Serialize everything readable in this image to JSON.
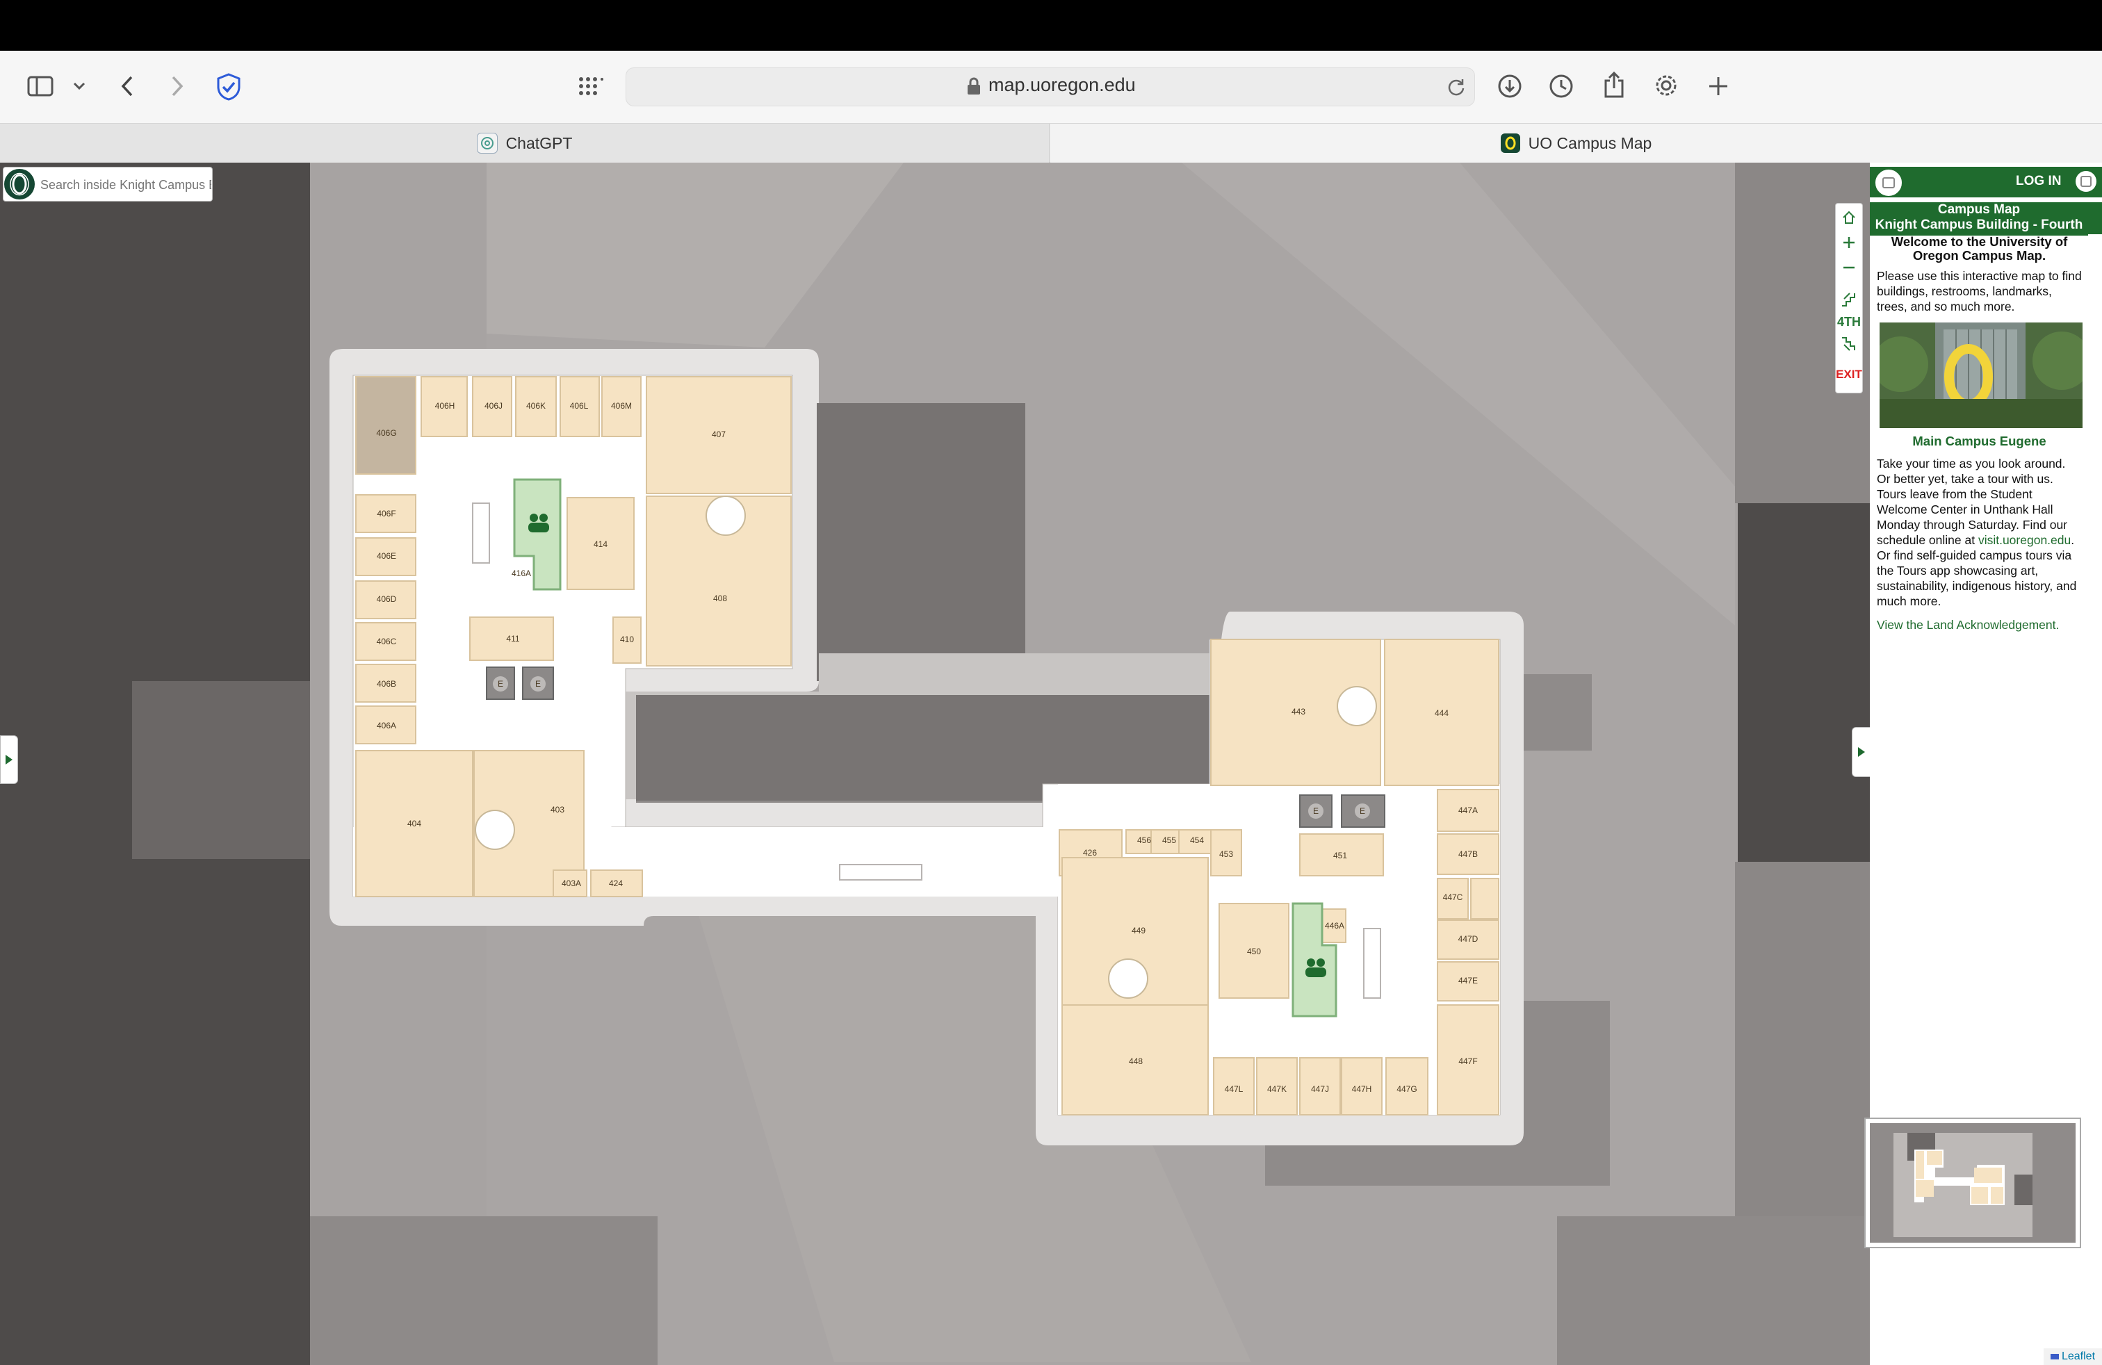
{
  "browser": {
    "url": "map.uoregon.edu",
    "tabs": [
      {
        "label": "ChatGPT",
        "active": false
      },
      {
        "label": "UO Campus Map",
        "active": true
      }
    ]
  },
  "map": {
    "search_placeholder": "Search inside Knight Campus Building - Fourth",
    "floor_label": "4TH",
    "exit_label": "EXIT",
    "rooms": [
      "406G",
      "406H",
      "406J",
      "406K",
      "406L",
      "406M",
      "407",
      "406F",
      "414",
      "416A",
      "406E",
      "408",
      "406D",
      "406C",
      "411",
      "410",
      "406B",
      "406A",
      "404",
      "403",
      "403A",
      "424",
      "426",
      "456",
      "455",
      "454",
      "453",
      "449",
      "450",
      "446A",
      "448",
      "447L",
      "447K",
      "447J",
      "447H",
      "447G",
      "443",
      "444",
      "447A",
      "451",
      "447B",
      "447C",
      "447D",
      "447E",
      "447F"
    ],
    "elevator_label": "E",
    "attribution": "Leaflet"
  },
  "panel": {
    "login_label": "LOG IN",
    "title_line1": "Campus Map",
    "title_line2": "Knight Campus Building - Fourth",
    "welcome_heading": "Welcome to the University of Oregon Campus Map.",
    "intro": "Please use this interactive map to find buildings, restrooms, landmarks, trees, and so much more.",
    "photo_caption": "Main Campus Eugene",
    "tour_text_1": "Take your time as you look around. Or better yet, take a tour with us. Tours leave from the Student Welcome Center in Unthank Hall Monday through Saturday. Find our schedule online at ",
    "tour_link": "visit.uoregon.edu",
    "tour_text_2": ". Or find self-guided campus tours via the Tours app showcasing art, sustainability, indigenous history, and much more.",
    "land_ack_link": "View the Land Acknowledgement."
  },
  "colors": {
    "brand_green": "#1f6b2e",
    "room_fill": "#f6e3c3",
    "map_dark": "#4e4b4a"
  }
}
